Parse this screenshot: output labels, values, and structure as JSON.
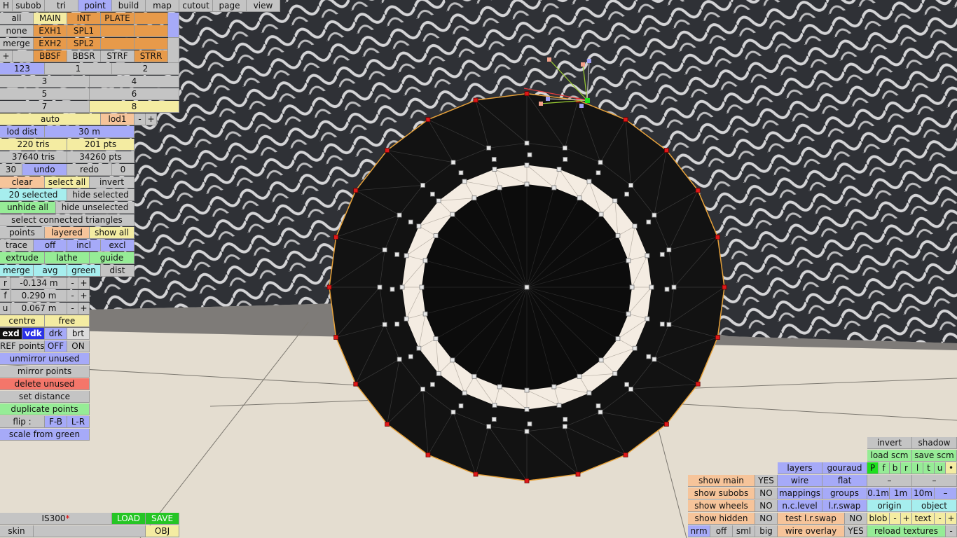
{
  "tabs": [
    "H",
    "subob",
    "tri",
    "point",
    "build",
    "map",
    "cutout",
    "page",
    "view"
  ],
  "active_tab": "point",
  "groups": {
    "row1": [
      "all",
      "MAIN",
      "INT",
      "PLATE",
      ""
    ],
    "row2": [
      "none",
      "EXH1",
      "SPL1",
      "",
      ""
    ],
    "row3": [
      "merge",
      "EXH2",
      "SPL2",
      "",
      ""
    ],
    "row4": [
      "+",
      "BBSF",
      "BBSR",
      "STRF",
      "STRR"
    ]
  },
  "layers": {
    "l123": "123",
    "l1": "1",
    "l2": "2",
    "l3": "3",
    "l4": "4",
    "l5": "5",
    "l6": "6",
    "l7": "7",
    "l8": "8"
  },
  "lod": {
    "auto": "auto",
    "lod1": "lod1",
    "minus": "-",
    "plus": "+",
    "dist_label": "lod dist",
    "dist_value": "30 m",
    "tris": "220 tris",
    "pts": "201 pts",
    "total_tris": "37640 tris",
    "total_pts": "34260 pts"
  },
  "undo": {
    "count": "30",
    "undo": "undo",
    "redo": "redo",
    "redo_count": "0"
  },
  "selection": {
    "clear": "clear",
    "select_all": "select all",
    "invert": "invert",
    "selected": "20 selected",
    "hide_selected": "hide selected",
    "unhide_all": "unhide all",
    "hide_unselected": "hide unselected",
    "connected": "select connected triangles"
  },
  "mode": {
    "points": "points",
    "layered": "layered",
    "show_all": "show all",
    "trace": "trace",
    "off": "off",
    "incl": "incl",
    "excl": "excl",
    "extrude": "extrude",
    "lathe": "lathe",
    "guide": "guide",
    "merge": "merge",
    "avg": "avg",
    "green": "green",
    "dist": "dist"
  },
  "coords": {
    "r_label": "r",
    "r_value": "-0.134 m",
    "f_label": "f",
    "f_value": "0.290 m",
    "u_label": "u",
    "u_value": "0.067 m",
    "minus": "-",
    "plus": "+",
    "centre": "centre",
    "free": "free"
  },
  "view_buttons": {
    "exd": "exd",
    "vdk": "vdk",
    "drk": "drk",
    "brt": "brt"
  },
  "ref_points": {
    "label": "REF points",
    "off": "OFF",
    "on": "ON"
  },
  "actions": {
    "unmirror": "unmirror unused",
    "mirror": "mirror points",
    "delete": "delete unused",
    "set_distance": "set distance",
    "duplicate": "duplicate points",
    "flip": "flip :",
    "fb": "F-B",
    "lr": "L-R",
    "scale": "scale from green"
  },
  "file": {
    "name": "IS300",
    "modified_mark": "*",
    "load": "LOAD",
    "save": "SAVE",
    "skin": "skin",
    "obj": "OBJ"
  },
  "right_panel": {
    "invert": "invert",
    "shadow": "shadow",
    "load_scm": "load scm",
    "save_scm": "save scm",
    "layers": "layers",
    "gouraud": "gouraud",
    "wire": "wire",
    "flat": "flat",
    "mappings": "mappings",
    "groups": "groups",
    "n_c_level": "n.c.level",
    "l_r_swap": "l.r.swap",
    "test_lr_swap": "test l.r.swap",
    "no": "NO",
    "wire_overlay": "wire overlay",
    "yes": "YES",
    "pfbrltu": [
      "P",
      "f",
      "b",
      "r",
      "l",
      "t",
      "u",
      "•"
    ],
    "dash": "–",
    "d01": "0.1m",
    "d1": "1m",
    "d10": "10m",
    "origin": "origin",
    "object": "object",
    "blob": "blob",
    "text": "text",
    "minus": "-",
    "plus": "+",
    "reload": "reload textures",
    "show_main": "show main",
    "show_subobs": "show subobs",
    "show_wheels": "show wheels",
    "show_hidden": "show hidden",
    "nrm": "nrm",
    "off": "off",
    "sml": "sml",
    "big": "big"
  },
  "colors": {
    "blue": "#a6aaf8",
    "orange": "#e79a4a",
    "yellow": "#f4eca2",
    "green": "#96ec96",
    "cyan": "#a6eeee",
    "red": "#f4766a"
  }
}
